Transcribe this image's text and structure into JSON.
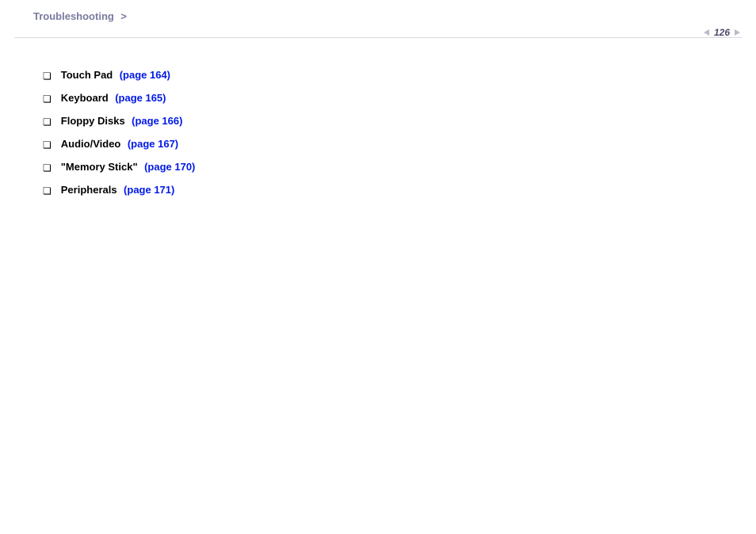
{
  "header": {
    "breadcrumb": "Troubleshooting",
    "separator": ">",
    "page_number": "126"
  },
  "content": {
    "items": [
      {
        "label": "Touch Pad",
        "link": "(page 164)"
      },
      {
        "label": "Keyboard",
        "link": "(page 165)"
      },
      {
        "label": "Floppy Disks",
        "link": "(page 166)"
      },
      {
        "label": "Audio/Video",
        "link": "(page 167)"
      },
      {
        "label": "\"Memory Stick\"",
        "link": "(page 170)"
      },
      {
        "label": "Peripherals",
        "link": "(page 171)"
      }
    ]
  }
}
